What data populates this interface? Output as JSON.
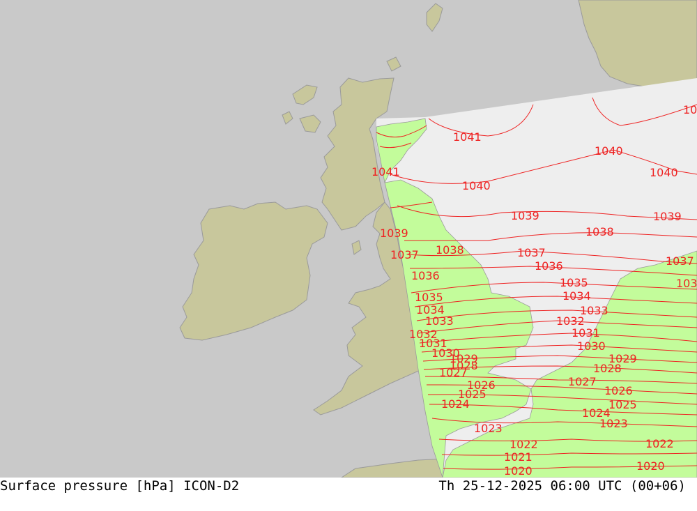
{
  "footer": {
    "left_title": "Surface pressure [hPa] ICON-D2",
    "right_time": "Th 25-12-2025 06:00 UTC (00+06)"
  },
  "colors": {
    "sea": "#c9c9c9",
    "land": "#c8c79c",
    "domain_sea": "#eeeeee",
    "domain_land": "#c3fc9b",
    "isobar": "#ee2222",
    "coast": "#9a9a9a"
  },
  "isobar_labels": [
    {
      "id": "lbl-1041-a",
      "text": "1041"
    },
    {
      "id": "lbl-1041-b",
      "text": "1041"
    },
    {
      "id": "lbl-1040-a",
      "text": "1040"
    },
    {
      "id": "lbl-1040-b",
      "text": "1040"
    },
    {
      "id": "lbl-1040-c",
      "text": "1040"
    },
    {
      "id": "lbl-10-edge",
      "text": "10"
    },
    {
      "id": "lbl-1039-a",
      "text": "1039"
    },
    {
      "id": "lbl-1039-b",
      "text": "1039"
    },
    {
      "id": "lbl-1039-c",
      "text": "1039"
    },
    {
      "id": "lbl-1038-a",
      "text": "1038"
    },
    {
      "id": "lbl-1038-b",
      "text": "1038"
    },
    {
      "id": "lbl-1037-a",
      "text": "1037"
    },
    {
      "id": "lbl-1037-b",
      "text": "1037"
    },
    {
      "id": "lbl-1037-c",
      "text": "1037"
    },
    {
      "id": "lbl-1036-a",
      "text": "1036"
    },
    {
      "id": "lbl-1036-b",
      "text": "1036"
    },
    {
      "id": "lbl-1035-a",
      "text": "1035"
    },
    {
      "id": "lbl-1035-b",
      "text": "1035"
    },
    {
      "id": "lbl-103-edge",
      "text": "103"
    },
    {
      "id": "lbl-1034-a",
      "text": "1034"
    },
    {
      "id": "lbl-1034-b",
      "text": "1034"
    },
    {
      "id": "lbl-1033-a",
      "text": "1033"
    },
    {
      "id": "lbl-1033-b",
      "text": "1033"
    },
    {
      "id": "lbl-1032-a",
      "text": "1032"
    },
    {
      "id": "lbl-1032-b",
      "text": "1032"
    },
    {
      "id": "lbl-1031-a",
      "text": "1031"
    },
    {
      "id": "lbl-1031-b",
      "text": "1031"
    },
    {
      "id": "lbl-1030-a",
      "text": "1030"
    },
    {
      "id": "lbl-1030-b",
      "text": "1030"
    },
    {
      "id": "lbl-1029-a",
      "text": "1029"
    },
    {
      "id": "lbl-1029-b",
      "text": "1029"
    },
    {
      "id": "lbl-1028-a",
      "text": "1028"
    },
    {
      "id": "lbl-1028-b",
      "text": "1028"
    },
    {
      "id": "lbl-1027-a",
      "text": "1027"
    },
    {
      "id": "lbl-1027-b",
      "text": "1027"
    },
    {
      "id": "lbl-1026-a",
      "text": "1026"
    },
    {
      "id": "lbl-1026-b",
      "text": "1026"
    },
    {
      "id": "lbl-1025-a",
      "text": "1025"
    },
    {
      "id": "lbl-1025-b",
      "text": "1025"
    },
    {
      "id": "lbl-1024-a",
      "text": "1024"
    },
    {
      "id": "lbl-1024-b",
      "text": "1024"
    },
    {
      "id": "lbl-1023-a",
      "text": "1023"
    },
    {
      "id": "lbl-1023-b",
      "text": "1023"
    },
    {
      "id": "lbl-1022-a",
      "text": "1022"
    },
    {
      "id": "lbl-1022-b",
      "text": "1022"
    },
    {
      "id": "lbl-1021-a",
      "text": "1021"
    },
    {
      "id": "lbl-1020-a",
      "text": "1020"
    },
    {
      "id": "lbl-1020-b",
      "text": "1020"
    }
  ]
}
